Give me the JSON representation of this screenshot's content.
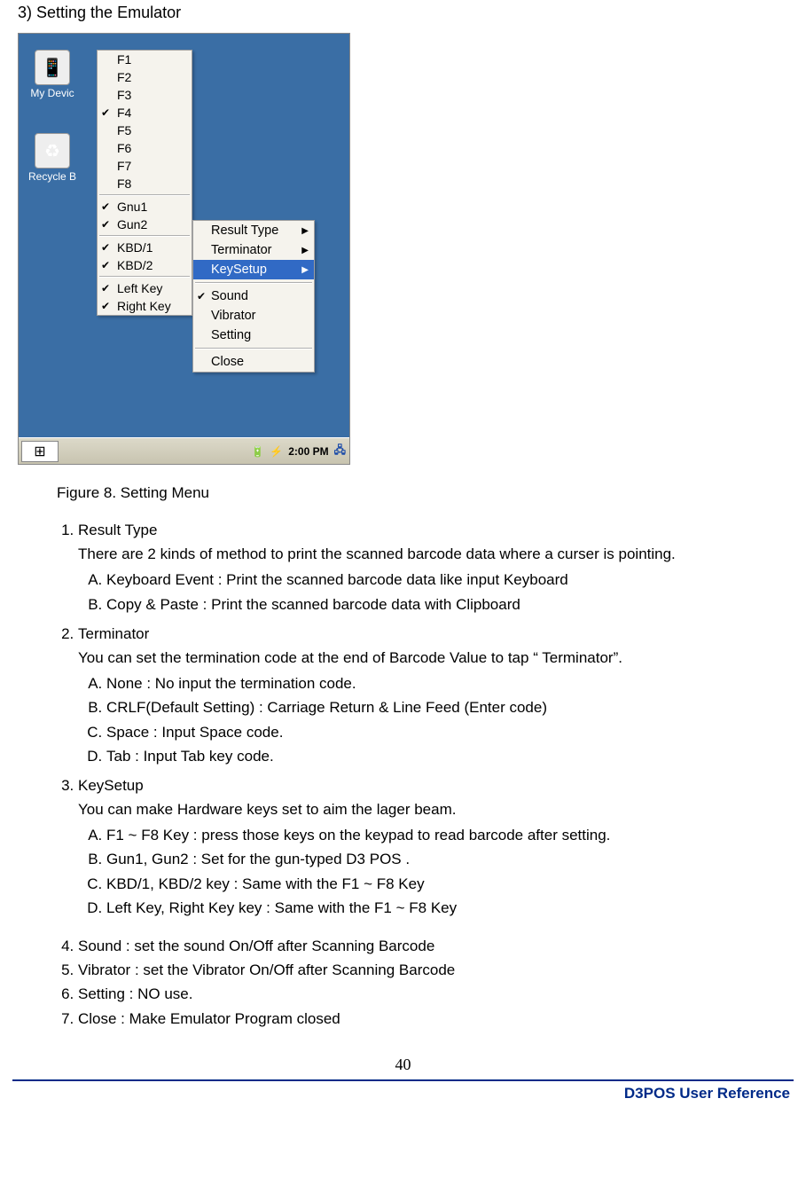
{
  "section_heading": "3) Setting the Emulator",
  "desktop": {
    "icon1_label": "My Devic",
    "icon2_label": "Recycle B"
  },
  "menu1": {
    "items": [
      {
        "label": "F1",
        "checked": false
      },
      {
        "label": "F2",
        "checked": false
      },
      {
        "label": "F3",
        "checked": false
      },
      {
        "label": "F4",
        "checked": true
      },
      {
        "label": "F5",
        "checked": false
      },
      {
        "label": "F6",
        "checked": false
      },
      {
        "label": "F7",
        "checked": false
      },
      {
        "label": "F8",
        "checked": false
      }
    ],
    "group2": [
      {
        "label": "Gnu1",
        "checked": true
      },
      {
        "label": "Gun2",
        "checked": true
      }
    ],
    "group3": [
      {
        "label": "KBD/1",
        "checked": true
      },
      {
        "label": "KBD/2",
        "checked": true
      }
    ],
    "group4": [
      {
        "label": "Left Key",
        "checked": true
      },
      {
        "label": "Right Key",
        "checked": true
      }
    ]
  },
  "menu2": {
    "items": [
      {
        "label": "Result Type",
        "submenu": true,
        "checked": false,
        "highlight": false
      },
      {
        "label": "Terminator",
        "submenu": true,
        "checked": false,
        "highlight": false
      },
      {
        "label": "KeySetup",
        "submenu": true,
        "checked": false,
        "highlight": true
      }
    ],
    "group2": [
      {
        "label": "Sound",
        "submenu": false,
        "checked": true
      },
      {
        "label": "Vibrator",
        "submenu": false,
        "checked": false
      },
      {
        "label": "Setting",
        "submenu": false,
        "checked": false
      }
    ],
    "group3": [
      {
        "label": "Close",
        "submenu": false,
        "checked": false
      }
    ]
  },
  "taskbar": {
    "time": "2:00 PM"
  },
  "figure_caption": "Figure 8. Setting Menu",
  "body": {
    "item1_title": "Result Type",
    "item1_desc": "There are 2 kinds of method to print the scanned barcode data where a curser is pointing.",
    "item1_a": "Keyboard Event : Print the scanned barcode data like input Keyboard",
    "item1_b": "Copy & Paste : Print the scanned barcode data with Clipboard",
    "item2_title": "Terminator",
    "item2_desc": "You can set the termination code at the end of Barcode Value to tap “ Terminator”.",
    "item2_a": "None : No input the termination code.",
    "item2_b": "CRLF(Default Setting) : Carriage Return & Line Feed (Enter code)",
    "item2_c": "Space : Input Space code.",
    "item2_d": "Tab : Input Tab key code.",
    "item3_title": "KeySetup",
    "item3_desc": "You can make Hardware keys set to aim the lager beam.",
    "item3_a": "F1 ~ F8 Key : press those keys on the keypad to read barcode after setting.",
    "item3_b": "Gun1, Gun2 : Set for the gun-typed D3 POS .",
    "item3_c": "KBD/1, KBD/2 key : Same with the F1 ~ F8 Key",
    "item3_d": "Left Key, Right Key key : Same with the F1 ~ F8 Key",
    "item4": "Sound : set the sound On/Off after Scanning Barcode",
    "item5": "Vibrator : set the Vibrator On/Off after Scanning Barcode",
    "item6": "Setting : NO use.",
    "item7": "Close : Make Emulator Program closed"
  },
  "page_number": "40",
  "footer": "D3POS User Reference"
}
